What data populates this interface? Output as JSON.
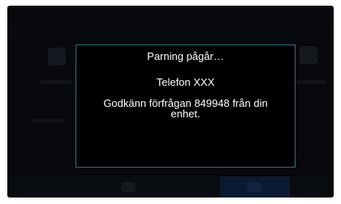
{
  "dialog": {
    "title": "Parning pågår…",
    "device_name": "Telefon XXX",
    "message": "Godkänn förfrågan 849948 från din enhet."
  },
  "colors": {
    "display_background": "#07090c",
    "dialog_background": "#000000",
    "dialog_border": "#2e6d8a",
    "text": "#ffffff",
    "active_tab": "#0b1a33"
  }
}
